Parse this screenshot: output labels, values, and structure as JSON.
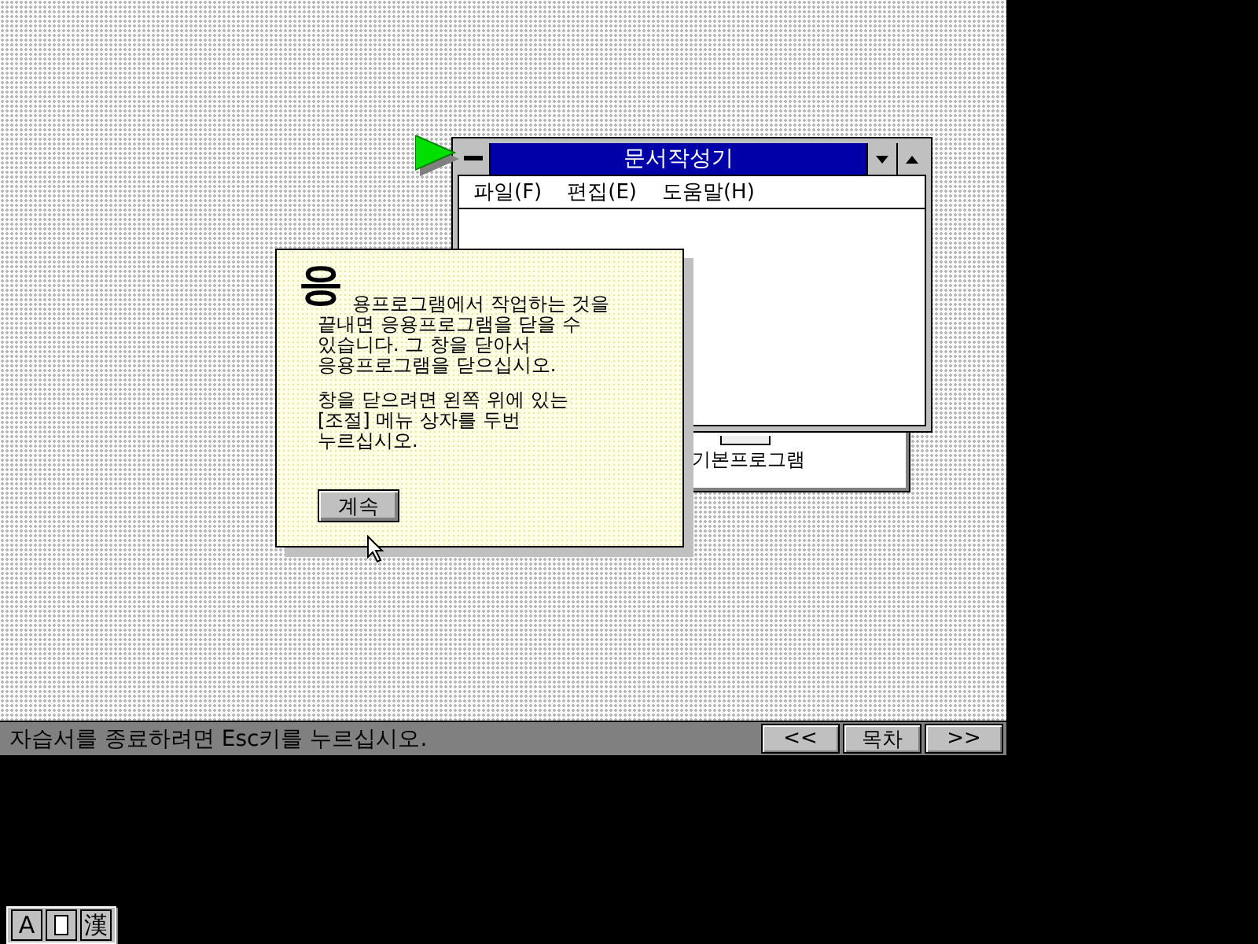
{
  "background_window": {
    "icon_label": "기본프로그램"
  },
  "window": {
    "title": "문서작성기",
    "menu": [
      "파일(F)",
      "편집(E)",
      "도움말(H)"
    ]
  },
  "dialog": {
    "initial": "응",
    "paragraphs": [
      [
        "용프로그램에서 작업하는 것을",
        "끝내면 응용프로그램을 닫을 수",
        "있습니다. 그 창을 닫아서",
        "응용프로그램을 닫으십시오."
      ],
      [
        "창을 닫으려면 왼쪽 위에 있는",
        "[조절] 메뉴 상자를 두번",
        "누르십시오."
      ]
    ],
    "button": "계속"
  },
  "status_bar": {
    "message": "자습서를 종료하려면 Esc키를 누르십시오.",
    "buttons": [
      "<<",
      "목차",
      ">>"
    ]
  },
  "ime": {
    "mode": "A",
    "hanja": "漢"
  }
}
